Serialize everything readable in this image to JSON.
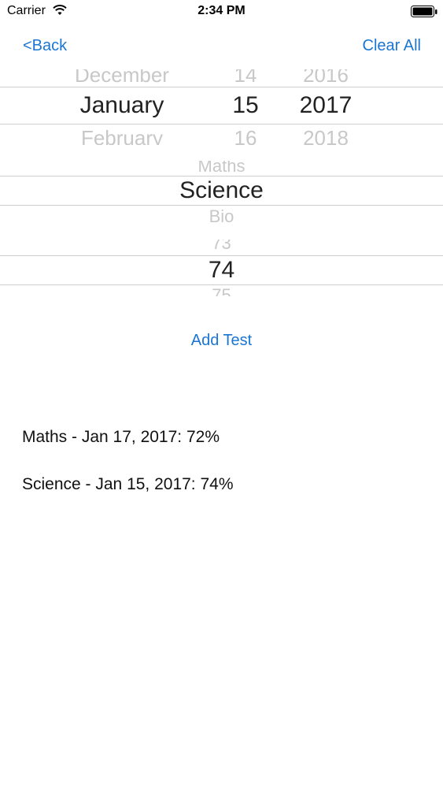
{
  "status_bar": {
    "carrier": "Carrier",
    "time": "2:34 PM"
  },
  "nav": {
    "back_label": "<Back",
    "clear_all_label": "Clear All"
  },
  "date_picker": {
    "month": {
      "above": "December",
      "selected": "January",
      "below": "February"
    },
    "day": {
      "above": "14",
      "selected": "15",
      "below": "16"
    },
    "year": {
      "above": "2016",
      "selected": "2017",
      "below": "2018"
    }
  },
  "subject_picker": {
    "above": "Maths",
    "selected": "Science",
    "below": "Bio"
  },
  "score_picker": {
    "above": "73",
    "selected": "74",
    "below": "75"
  },
  "add_test_label": "Add Test",
  "results": [
    {
      "text": "Maths - Jan 17, 2017: 72%"
    },
    {
      "text": "Science - Jan 15, 2017: 74%"
    }
  ],
  "colors": {
    "accent": "#1a76d2"
  }
}
